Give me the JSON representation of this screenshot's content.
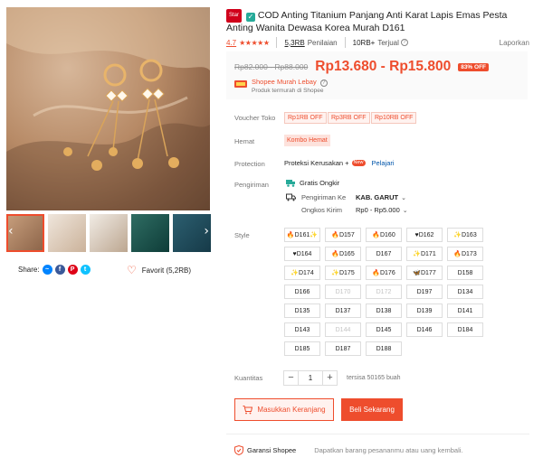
{
  "product": {
    "badge": "Star",
    "title": "COD Anting Titanium Panjang Anti Karat Lapis Emas Pesta Anting Wanita Dewasa Korea Murah D161",
    "rating": "4.7",
    "stars": "★★★★★",
    "ratings_count": "5,3RB",
    "ratings_label": "Penilaian",
    "sold_count": "10RB+",
    "sold_label": "Terjual",
    "report": "Laporkan"
  },
  "price": {
    "original": "Rp82.000 - Rp88.000",
    "current": "Rp13.680 - Rp15.800",
    "discount": "83% OFF"
  },
  "store": {
    "name": "Shopee Murah Lebay",
    "subtitle": "Produk termurah di Shopee"
  },
  "labels": {
    "voucher": "Voucher Toko",
    "hemat": "Hemat",
    "protection": "Protection",
    "shipping": "Pengiriman",
    "style": "Style",
    "quantity": "Kuantitas"
  },
  "vouchers": [
    "Rp1RB OFF",
    "Rp3RB OFF",
    "Rp10RB OFF"
  ],
  "combo": "Kombo Hemat",
  "protection": {
    "text": "Proteksi Kerusakan +",
    "new_badge": "New",
    "learn": "Pelajari"
  },
  "shipping": {
    "free": "Gratis Ongkir",
    "to_label": "Pengiriman Ke",
    "to_value": "KAB. GARUT",
    "cost_label": "Ongkos Kirim",
    "cost_value": "Rp0 - Rp5.000"
  },
  "styles": [
    {
      "label": "🔥D161✨",
      "disabled": false
    },
    {
      "label": "🔥D157",
      "disabled": false
    },
    {
      "label": "🔥D160",
      "disabled": false
    },
    {
      "label": "♥D162",
      "disabled": false
    },
    {
      "label": "✨D163",
      "disabled": false
    },
    {
      "label": "♥D164",
      "disabled": false
    },
    {
      "label": "🔥D165",
      "disabled": false
    },
    {
      "label": "D167",
      "disabled": false
    },
    {
      "label": "✨D171",
      "disabled": false
    },
    {
      "label": "🔥D173",
      "disabled": false
    },
    {
      "label": "✨D174",
      "disabled": false
    },
    {
      "label": "✨D175",
      "disabled": false
    },
    {
      "label": "🔥D176",
      "disabled": false
    },
    {
      "label": "🦋D177",
      "disabled": false
    },
    {
      "label": "D158",
      "disabled": false
    },
    {
      "label": "D166",
      "disabled": false
    },
    {
      "label": "D170",
      "disabled": true
    },
    {
      "label": "D172",
      "disabled": true
    },
    {
      "label": "D197",
      "disabled": false
    },
    {
      "label": "D134",
      "disabled": false
    },
    {
      "label": "D135",
      "disabled": false
    },
    {
      "label": "D137",
      "disabled": false
    },
    {
      "label": "D138",
      "disabled": false
    },
    {
      "label": "D139",
      "disabled": false
    },
    {
      "label": "D141",
      "disabled": false
    },
    {
      "label": "D143",
      "disabled": false
    },
    {
      "label": "D144",
      "disabled": true
    },
    {
      "label": "D145",
      "disabled": false
    },
    {
      "label": "D146",
      "disabled": false
    },
    {
      "label": "D184",
      "disabled": false
    },
    {
      "label": "D185",
      "disabled": false
    },
    {
      "label": "D187",
      "disabled": false
    },
    {
      "label": "D188",
      "disabled": false
    }
  ],
  "quantity": {
    "minus": "−",
    "value": "1",
    "plus": "+",
    "stock": "tersisa 50165 buah"
  },
  "buttons": {
    "cart": "Masukkan Keranjang",
    "buy": "Beli Sekarang"
  },
  "guarantee": {
    "title": "Garansi Shopee",
    "subtitle": "Dapatkan barang pesananmu atau uang kembali."
  },
  "share": {
    "label": "Share:",
    "favorite": "Favorit (5,2RB)"
  },
  "colors": {
    "accent": "#ee4d2d",
    "verified": "#26aa99",
    "link": "#0055aa"
  }
}
